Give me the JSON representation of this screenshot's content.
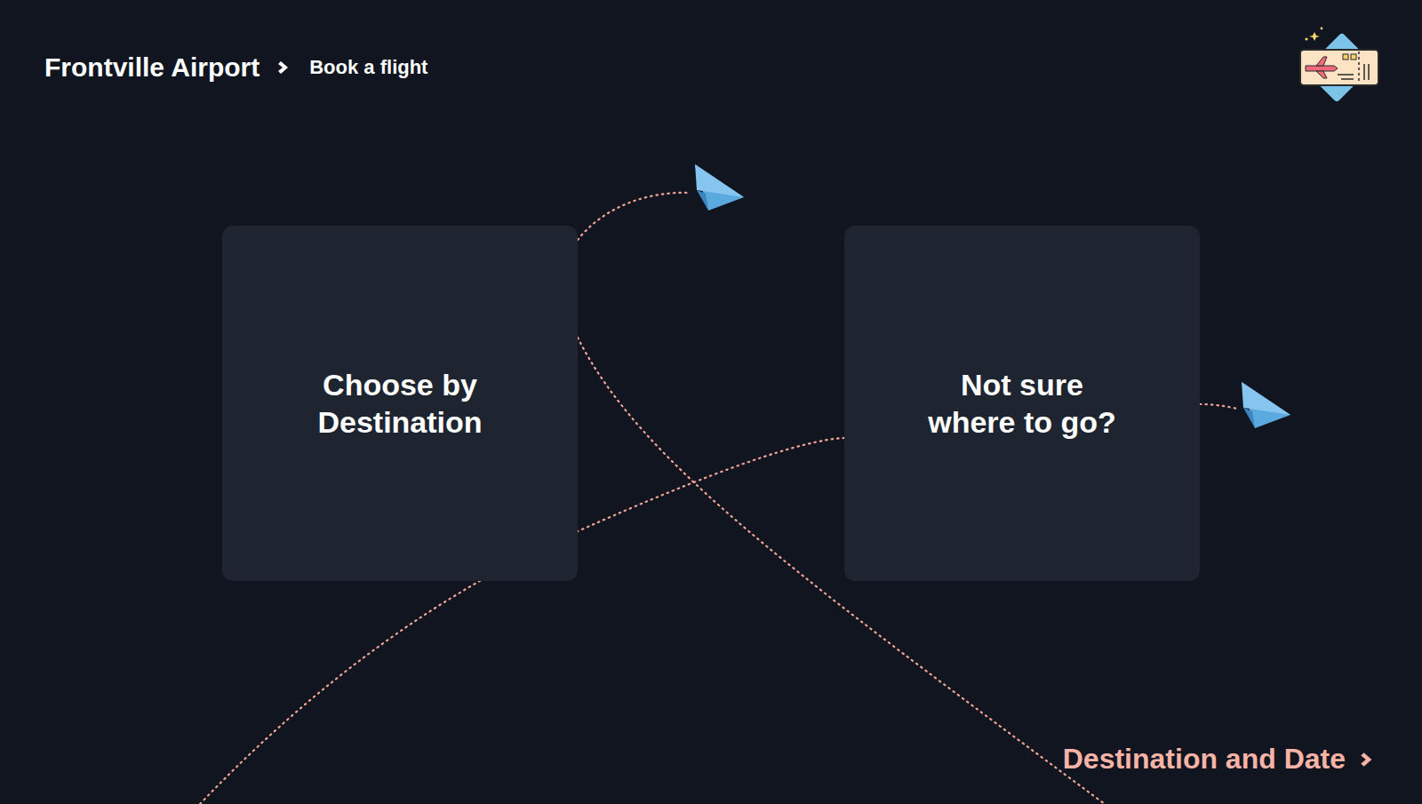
{
  "header": {
    "title": "Frontville Airport",
    "breadcrumb": "Book a flight"
  },
  "cards": [
    {
      "label": "Choose by Destination",
      "lines": [
        "Choose by",
        "Destination"
      ]
    },
    {
      "label": "Not sure where to go?",
      "lines": [
        "Not sure",
        "where to go?"
      ]
    }
  ],
  "footer": {
    "link": "Destination and Date"
  }
}
